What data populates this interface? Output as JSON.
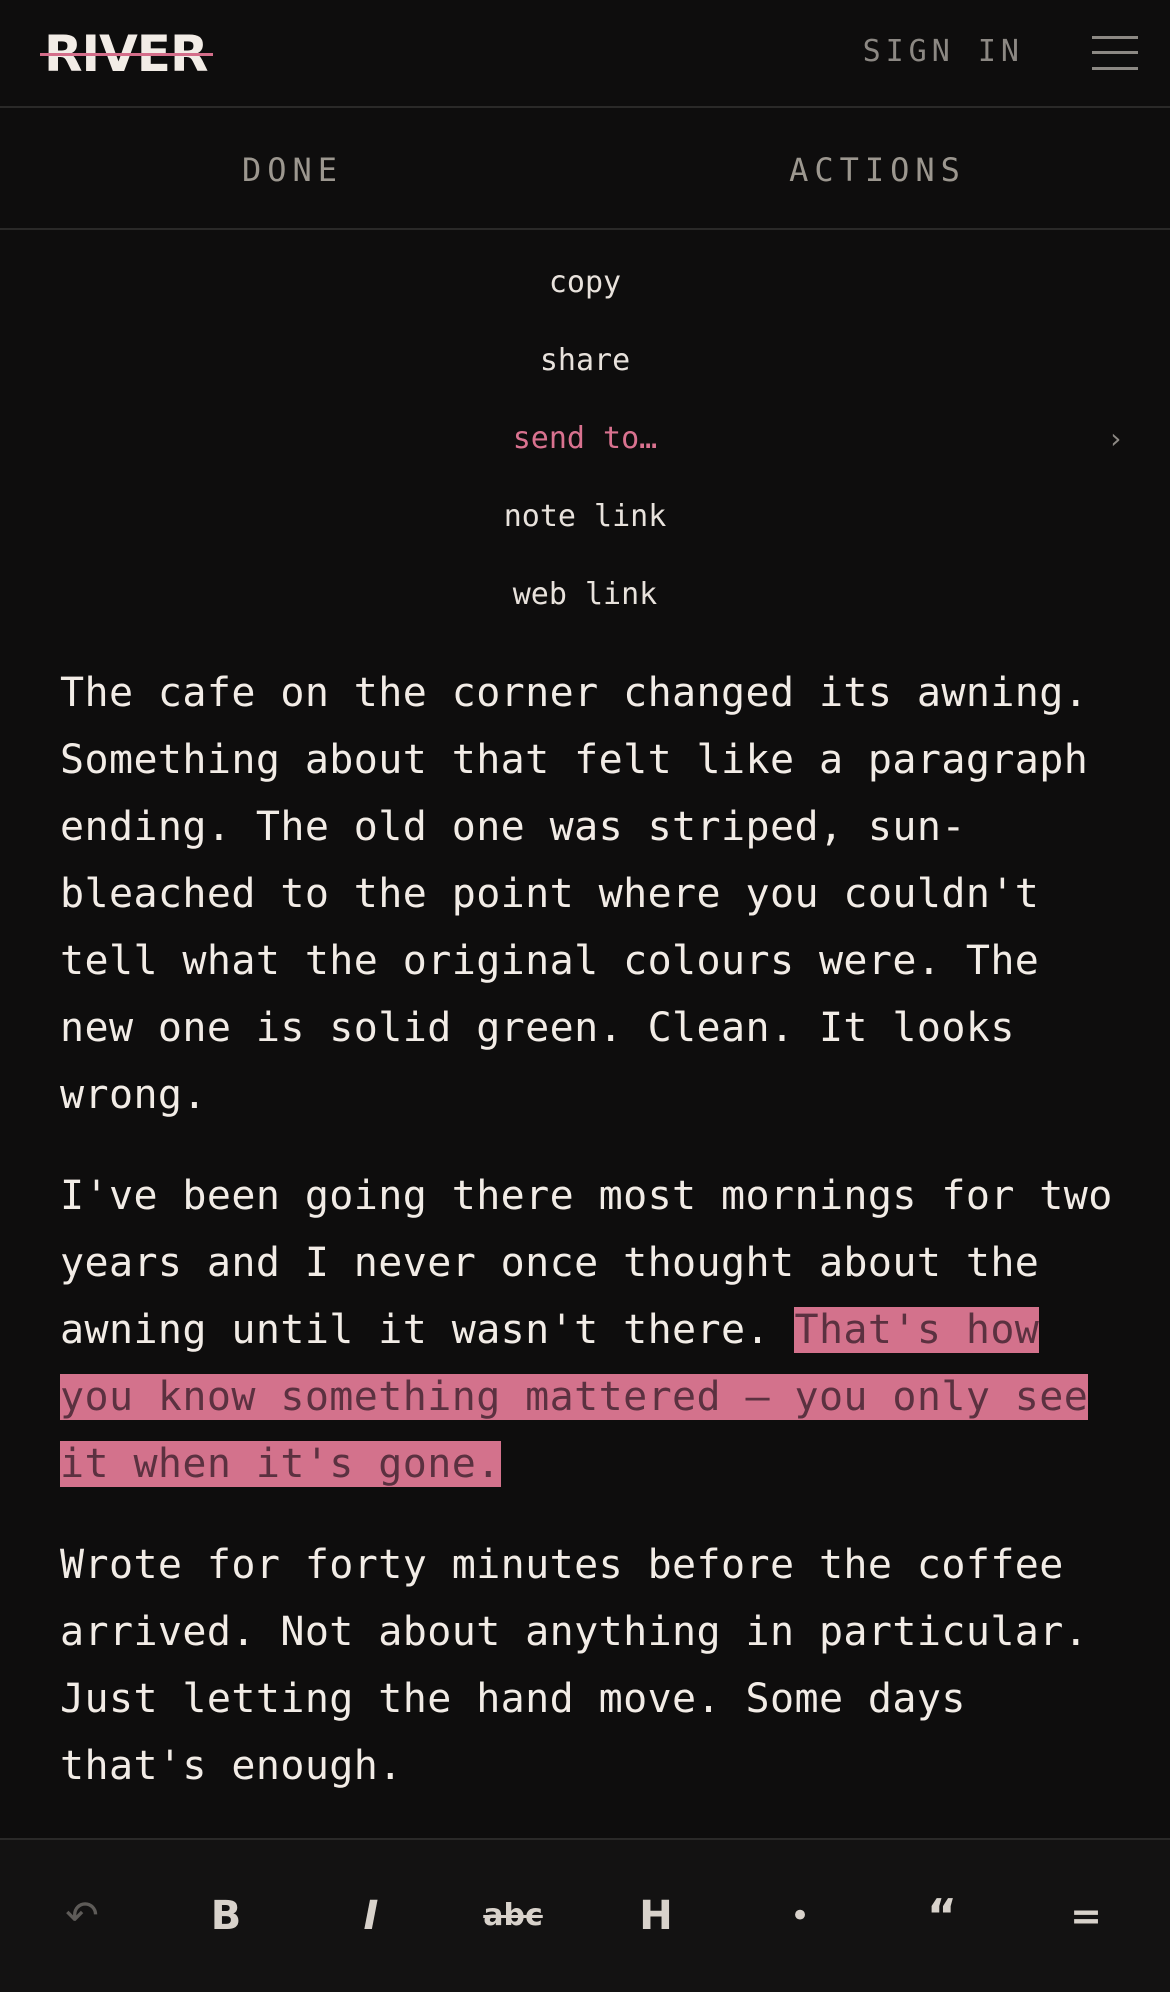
{
  "header": {
    "logo": "RIVER",
    "sign_in": "SIGN IN"
  },
  "tabs": [
    {
      "label": "DONE"
    },
    {
      "label": "ACTIONS"
    }
  ],
  "actions_menu": {
    "items": [
      {
        "label": "copy"
      },
      {
        "label": "share"
      },
      {
        "label": "send to…"
      },
      {
        "label": "note link"
      },
      {
        "label": "web link"
      }
    ],
    "active_index": 2,
    "submenu_chevron": "›"
  },
  "document": {
    "paragraph_1": "The cafe on the corner changed its awning. Something about that felt like a paragraph ending. The old one was striped, sun-bleached to the point where you couldn't tell what the original colours were. The new one is solid green. Clean. It looks wrong.",
    "paragraph_2_plain": "I've been going there most mornings for two years and I never once thought about the awning until it wasn't there. ",
    "paragraph_2_selected": "That's how you know something mattered — you only see it when it's gone.",
    "paragraph_3": "Wrote for forty minutes before the coffee arrived. Not about anything in particular. Just letting the hand move. Some days that's enough."
  },
  "toolbar": {
    "undo": "↶",
    "bold": "B",
    "italic": "I",
    "strikethrough": "abc",
    "heading": "H",
    "bullet": "•",
    "quote": "“",
    "divider": "="
  },
  "colors": {
    "background": "#0e0d0d",
    "accent": "#d9728f",
    "selection": "#d3728c",
    "text": "#efe9e3",
    "muted": "#8c8883"
  }
}
